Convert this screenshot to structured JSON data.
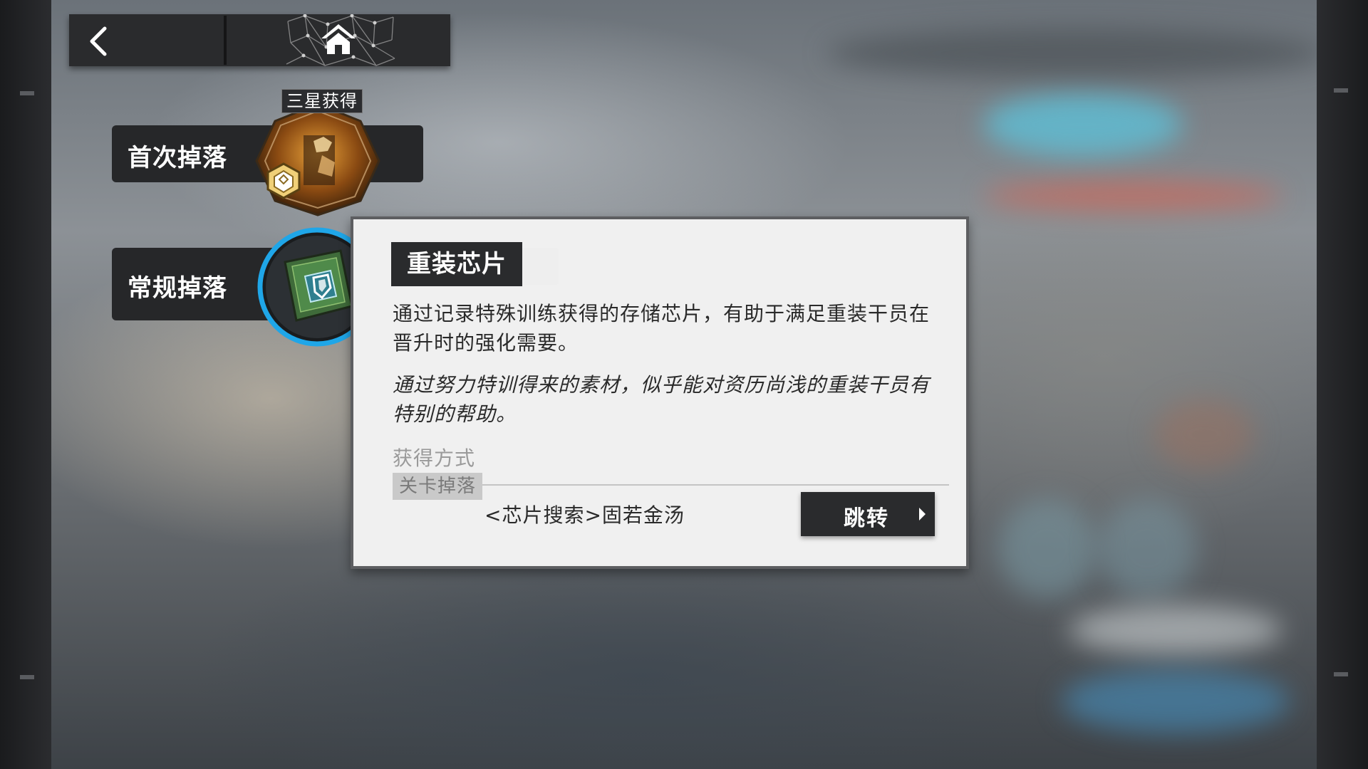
{
  "nav": {
    "back_icon": "chevron-left-icon",
    "home_icon": "home-icon"
  },
  "drops": {
    "first_label": "首次掉落",
    "regular_label": "常规掉落",
    "first_item_badge": "三星获得"
  },
  "item": {
    "name": "重装芯片",
    "description": "通过记录特殊训练获得的存储芯片，有助于满足重装干员在晋升时的强化需要。",
    "flavor": "通过努力特训得来的素材，似乎能对资历尚浅的重装干员有特别的帮助。",
    "source_label": "获得方式",
    "source_tag": "关卡掉落",
    "stage": "<芯片搜索>固若金汤",
    "jump_label": "跳转"
  },
  "colors": {
    "panel_bg": "#f0f0f0",
    "dark": "#2a2b2d",
    "accent_ring": "#1fa6e8"
  }
}
